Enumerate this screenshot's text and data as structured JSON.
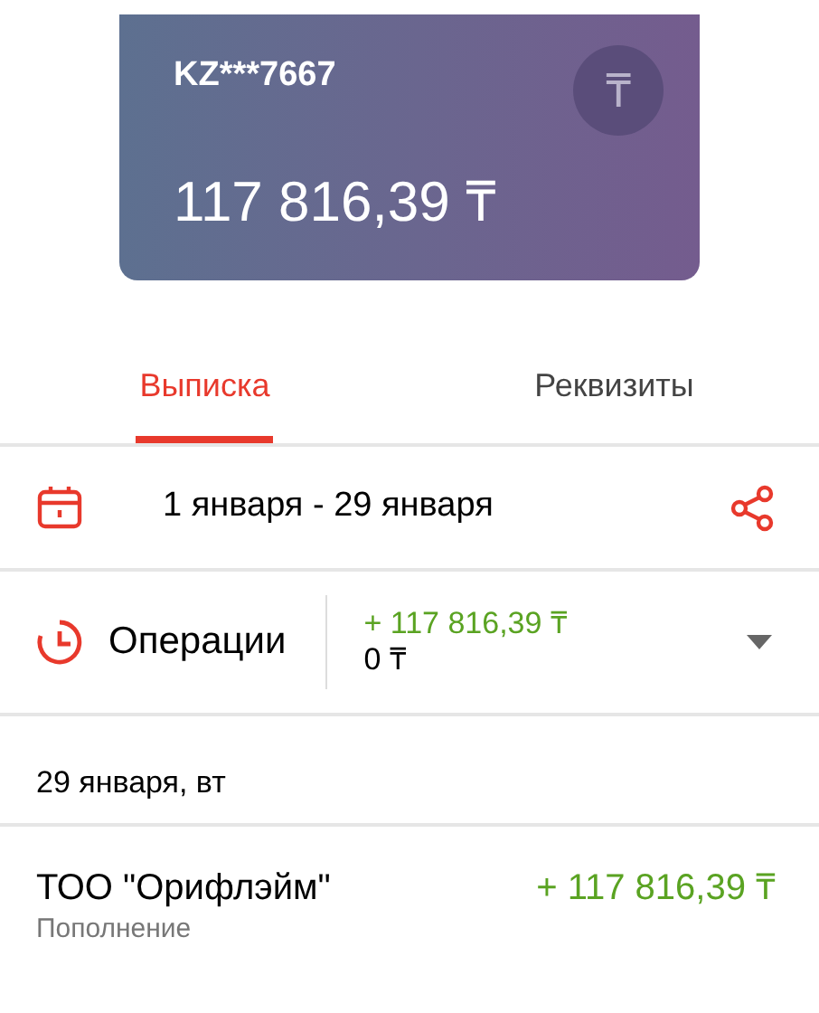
{
  "card": {
    "account": "KZ***7667",
    "balance": "117 816,39 ₸",
    "currency_symbol": "₸"
  },
  "tabs": [
    {
      "label": "Выписка",
      "selected": true
    },
    {
      "label": "Реквизиты",
      "selected": false
    }
  ],
  "period": {
    "range": "1 января - 29 января"
  },
  "operations": {
    "label": "Операции",
    "income": "+ 117 816,39 ₸",
    "expense": "0 ₸",
    "expanded": false
  },
  "days": [
    {
      "date": "29 января, вт",
      "transactions": [
        {
          "title": "ТОО \"Орифлэйм\"",
          "subtitle": "Пополнение",
          "amount": "+ 117 816,39 ₸"
        }
      ]
    }
  ]
}
